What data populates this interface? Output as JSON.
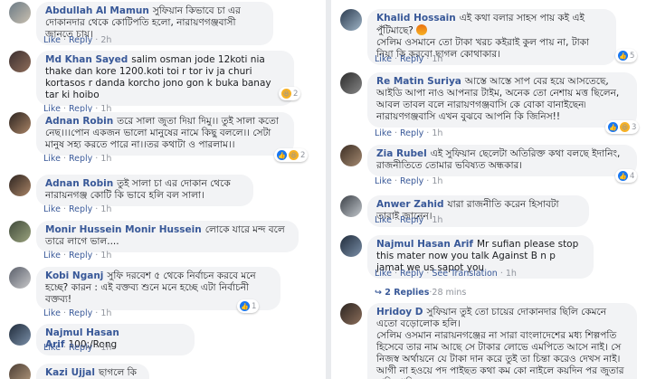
{
  "actions": {
    "like": "Like",
    "reply": "Reply",
    "see_translation": "See Translation",
    "dot": "·"
  },
  "left": [
    {
      "name": "Abdullah Al Mamun",
      "text": "সুফিয়ান কিভাবে চা এর দোকানদার থেকে কোটিপতি হলো, নারায়ণগঞ্জবাসী জানতে চায়।",
      "time": "2h"
    },
    {
      "name": "Md Khan Sayed",
      "text": "salim osman jode 12koti nia thake dan kore 1200.koti toi r tor iv ja churi kortasos r danda korcho jono gon k buka banay tar ki hoibo",
      "time": "1h",
      "reaction": {
        "type": "haha",
        "count": "2"
      }
    },
    {
      "name": "Adnan Robin",
      "text": "তরে সালা জুতা দিয়া দিমু।। তুই সালা কতো নেছ।।।পোন একজন ভালো মানুষের নামে কিছু বললে।। সেটা মানুষ সহ্য করতে পারে না।।তর কথাটা ও পারলাম।।",
      "time": "1h",
      "reaction": {
        "type": "both",
        "count": "2"
      }
    },
    {
      "name": "Adnan Robin",
      "text": "তুই সালা চা এর দোকান থেকে নারায়নগঞ্জ কোটি কি ভাবে হলি বল সালা।",
      "time": "1h"
    },
    {
      "name": "Monir Hussein Monir Hussein",
      "text": "লোকে যারে মন্দ বলে তারে লাগে ভাল....",
      "time": "1h"
    },
    {
      "name": "Kobi Nganj",
      "text": "সুফি দরবেশ ৫ থেকে নির্বাচন করবে মনে হচ্ছে? কারন : এই বক্তব্য শুনে মনে হচ্ছে এটা নির্বাচনী বক্তব্য!",
      "time": "1h",
      "reaction": {
        "type": "like",
        "count": "1"
      }
    },
    {
      "name": "Najmul Hasan Arif",
      "text": "100;/Rong",
      "time": "1h"
    },
    {
      "name": "Kazi Ujjal",
      "text": "ছাগলে কি কয়",
      "time": ""
    }
  ],
  "right": [
    {
      "name": "Khalid Hossain",
      "text": "এই কথা বলার সাহস পায় কই এই পুঁটিমাছে?",
      "text2": "সেলিম ওসমানে তো টাকা খরচ কইরাই কুল পায় না, টাকা নিয়া কি করবো ছাগল কোথাকার।",
      "time": "1h",
      "reaction": {
        "type": "like",
        "count": "5"
      }
    },
    {
      "name": "Re Matin Suriya",
      "text": "আস্তে আস্তে সাপ বের হয়ে আসতেছে, আইডি আপা নাও আপনার টাইম, অনেক তো নেশায় মত্ত ছিলেন, আবল তাবল বলে নারায়ণগঞ্জবাসি কে বোকা বানাইছেন৷ নারায়ণগঞ্জবাসি এখন বুঝবে আপনি কি জিনিস!!",
      "time": "1h",
      "reaction": {
        "type": "both",
        "count": "3"
      }
    },
    {
      "name": "Zia Rubel",
      "text": "এই সুফিয়ান ছেলেটা অতিরিক্ত কথা বলছে ইদানিং, রাজনীতিতে তোমার ভবিষ্যত অন্ধকার।",
      "time": "1h",
      "reaction": {
        "type": "like",
        "count": "4"
      }
    },
    {
      "name": "Anwer Zahid",
      "text": "যারা রাজনীতি করেন হিসাবটা তারাই জানেন।",
      "time": "1h"
    },
    {
      "name": "Najmul Hasan Arif",
      "text": "Mr sufian please stop this mater now you talk Against B n p jamat we us sapot you",
      "time": "1h",
      "replies": "2 Replies",
      "replies_time": "28 mins"
    },
    {
      "name": "Hridoy D",
      "text": "সুফিয়ান তুই তো চায়ের দোকানদার ছিলি কেমনে এতো বড়োলোক হলি।",
      "text2": "সেলিম ওসমান নারায়নগঞ্জের না সারা বাংলাদেশের মধ্য শিল্পপতি হিসেবে তার নাম আছে সে টাকার লোভে এমপিতে আসে নাই। সে নিজস্ব অর্থায়নে যে টাকা দান করে তুই তা চিন্তা করেও দেখস নাই। আগী না হওয়ে পদ পাইছত কথা কম কো নাইলে কয়দিন পর জুতার বাড়ি খাবি।",
      "time": ""
    }
  ]
}
